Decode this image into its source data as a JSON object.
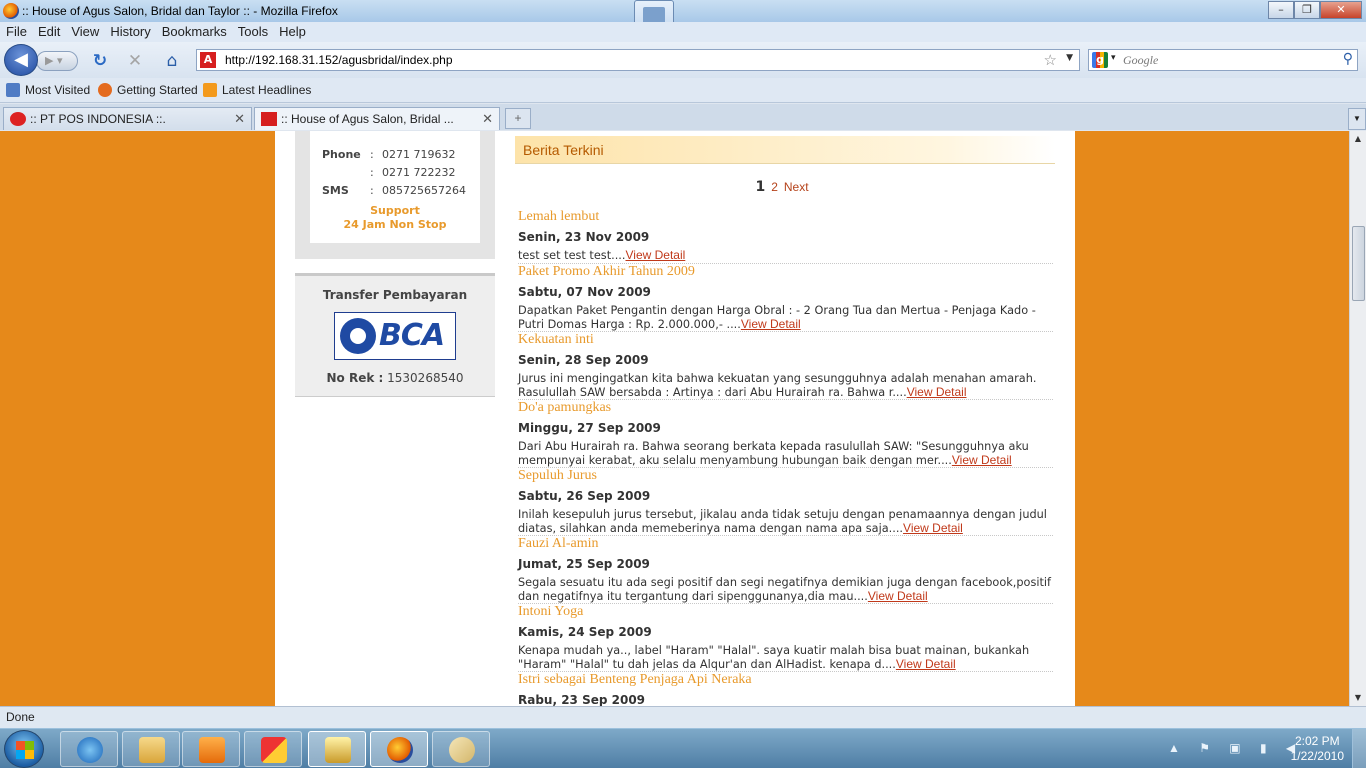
{
  "window": {
    "title": ":: House of Agus Salon, Bridal dan Taylor :: - Mozilla Firefox"
  },
  "menu": [
    "File",
    "Edit",
    "View",
    "History",
    "Bookmarks",
    "Tools",
    "Help"
  ],
  "nav": {
    "url": "http://192.168.31.152/agusbridal/index.php",
    "search_placeholder": "Google"
  },
  "bookmarks": [
    "Most Visited",
    "Getting Started",
    "Latest Headlines"
  ],
  "tabs": [
    {
      "label": ":: PT POS INDONESIA ::."
    },
    {
      "label": ":: House of Agus Salon, Bridal ..."
    }
  ],
  "contact": {
    "phone_label": "Phone",
    "sep": ":",
    "phone1": "0271 719632",
    "phone2": "0271 722232",
    "sms_label": "SMS",
    "sms": "085725657264",
    "support1": "Support",
    "support2": "24 Jam Non Stop"
  },
  "transfer": {
    "heading": "Transfer Pembayaran",
    "bank": "BCA",
    "norek_label": "No Rek :",
    "norek": "1530268540"
  },
  "news": {
    "heading": "Berita Terkini",
    "pager": {
      "current": "1",
      "page2": "2",
      "next": "Next"
    },
    "view_detail": "View Detail",
    "items": [
      {
        "title": "Lemah lembut",
        "date": "Senin, 23 Nov 2009",
        "desc": "test set test test...."
      },
      {
        "title": "Paket Promo Akhir Tahun 2009",
        "date": "Sabtu, 07 Nov 2009",
        "desc": "Dapatkan Paket Pengantin dengan Harga Obral : - 2 Orang Tua dan Mertua - Penjaga Kado - Putri Domas Harga : Rp. 2.000.000,- ...."
      },
      {
        "title": "Kekuatan inti",
        "date": "Senin, 28 Sep 2009",
        "desc": "Jurus ini mengingatkan kita bahwa kekuatan yang sesungguhnya adalah menahan amarah. Rasulullah SAW bersabda : Artinya : dari Abu Hurairah ra. Bahwa r...."
      },
      {
        "title": "Do'a pamungkas",
        "date": "Minggu, 27 Sep 2009",
        "desc": "Dari Abu Hurairah ra. Bahwa seorang berkata kepada rasulullah SAW: \"Sesungguhnya aku mempunyai kerabat, aku selalu menyambung hubungan baik dengan mer...."
      },
      {
        "title": "Sepuluh Jurus",
        "date": "Sabtu, 26 Sep 2009",
        "desc": "Inilah kesepuluh jurus tersebut, jikalau anda tidak setuju dengan penamaannya dengan judul diatas, silahkan anda memeberinya nama dengan nama apa saja...."
      },
      {
        "title": "Fauzi Al-amin",
        "date": "Jumat, 25 Sep 2009",
        "desc": "Segala sesuatu itu ada segi positif dan segi negatifnya demikian juga dengan facebook,positif dan negatifnya itu tergantung dari sipenggunanya,dia mau...."
      },
      {
        "title": "Intoni Yoga",
        "date": "Kamis, 24 Sep 2009",
        "desc": "Kenapa mudah ya.., label \"Haram\" \"Halal\". saya kuatir malah bisa buat mainan, bukankah \"Haram\" \"Halal\" tu dah jelas da Alqur'an dan AlHadist. kenapa d...."
      },
      {
        "title": "Istri sebagai Benteng Penjaga Api Neraka",
        "date": "Rabu, 23 Sep 2009",
        "desc": ""
      }
    ]
  },
  "status": "Done",
  "clock": {
    "time": "2:02 PM",
    "date": "1/22/2010"
  }
}
